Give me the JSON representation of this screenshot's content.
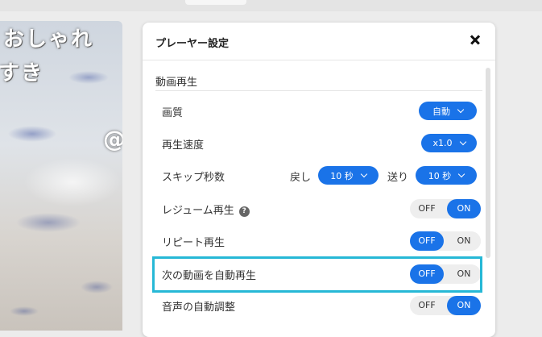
{
  "video": {
    "overlay_line1": "おしゃれ",
    "overlay_line2": "すき",
    "overlay_at": "@"
  },
  "panel": {
    "title": "プレーヤー設定",
    "section": "動画再生",
    "quality": {
      "label": "画質",
      "value": "自動"
    },
    "speed": {
      "label": "再生速度",
      "value": "x1.0"
    },
    "skip": {
      "label": "スキップ秒数",
      "back_label": "戻し",
      "back_value": "10 秒",
      "forward_label": "送り",
      "forward_value": "10 秒"
    },
    "resume": {
      "label": "レジューム再生",
      "help": "?",
      "off": "OFF",
      "on": "ON",
      "state": "on"
    },
    "repeat": {
      "label": "リピート再生",
      "off": "OFF",
      "on": "ON",
      "state": "off"
    },
    "autoplay_next": {
      "label": "次の動画を自動再生",
      "off": "OFF",
      "on": "ON",
      "state": "off"
    },
    "auto_volume": {
      "label": "音声の自動調整",
      "off": "OFF",
      "on": "ON",
      "state": "on"
    }
  },
  "colors": {
    "accent": "#1a73e8",
    "highlight": "#26b8d6"
  }
}
